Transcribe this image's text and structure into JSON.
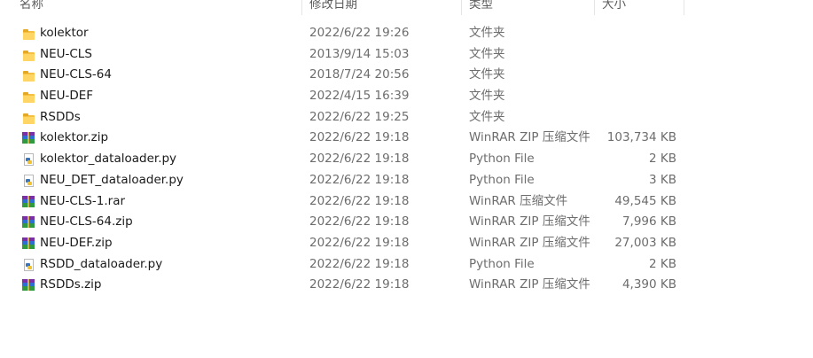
{
  "columns": {
    "name": "名称",
    "date": "修改日期",
    "type": "类型",
    "size": "大小"
  },
  "files": [
    {
      "icon": "folder-icon",
      "name": "kolektor",
      "date": "2022/6/22 19:26",
      "type": "文件夹",
      "size": ""
    },
    {
      "icon": "folder-icon",
      "name": "NEU-CLS",
      "date": "2013/9/14 15:03",
      "type": "文件夹",
      "size": ""
    },
    {
      "icon": "folder-icon",
      "name": "NEU-CLS-64",
      "date": "2018/7/24 20:56",
      "type": "文件夹",
      "size": ""
    },
    {
      "icon": "folder-icon",
      "name": "NEU-DEF",
      "date": "2022/4/15 16:39",
      "type": "文件夹",
      "size": ""
    },
    {
      "icon": "folder-icon",
      "name": "RSDDs",
      "date": "2022/6/22 19:25",
      "type": "文件夹",
      "size": ""
    },
    {
      "icon": "winrar-archive-icon",
      "name": "kolektor.zip",
      "date": "2022/6/22 19:18",
      "type": "WinRAR ZIP 压缩文件",
      "size": "103,734 KB"
    },
    {
      "icon": "python-file-icon",
      "name": "kolektor_dataloader.py",
      "date": "2022/6/22 19:18",
      "type": "Python File",
      "size": "2 KB"
    },
    {
      "icon": "python-file-icon",
      "name": "NEU_DET_dataloader.py",
      "date": "2022/6/22 19:18",
      "type": "Python File",
      "size": "3 KB"
    },
    {
      "icon": "winrar-archive-icon",
      "name": "NEU-CLS-1.rar",
      "date": "2022/6/22 19:18",
      "type": "WinRAR 压缩文件",
      "size": "49,545 KB"
    },
    {
      "icon": "winrar-archive-icon",
      "name": "NEU-CLS-64.zip",
      "date": "2022/6/22 19:18",
      "type": "WinRAR ZIP 压缩文件",
      "size": "7,996 KB"
    },
    {
      "icon": "winrar-archive-icon",
      "name": "NEU-DEF.zip",
      "date": "2022/6/22 19:18",
      "type": "WinRAR ZIP 压缩文件",
      "size": "27,003 KB"
    },
    {
      "icon": "python-file-icon",
      "name": "RSDD_dataloader.py",
      "date": "2022/6/22 19:18",
      "type": "Python File",
      "size": "2 KB"
    },
    {
      "icon": "winrar-archive-icon",
      "name": "RSDDs.zip",
      "date": "2022/6/22 19:18",
      "type": "WinRAR ZIP 压缩文件",
      "size": "4,390 KB"
    }
  ]
}
